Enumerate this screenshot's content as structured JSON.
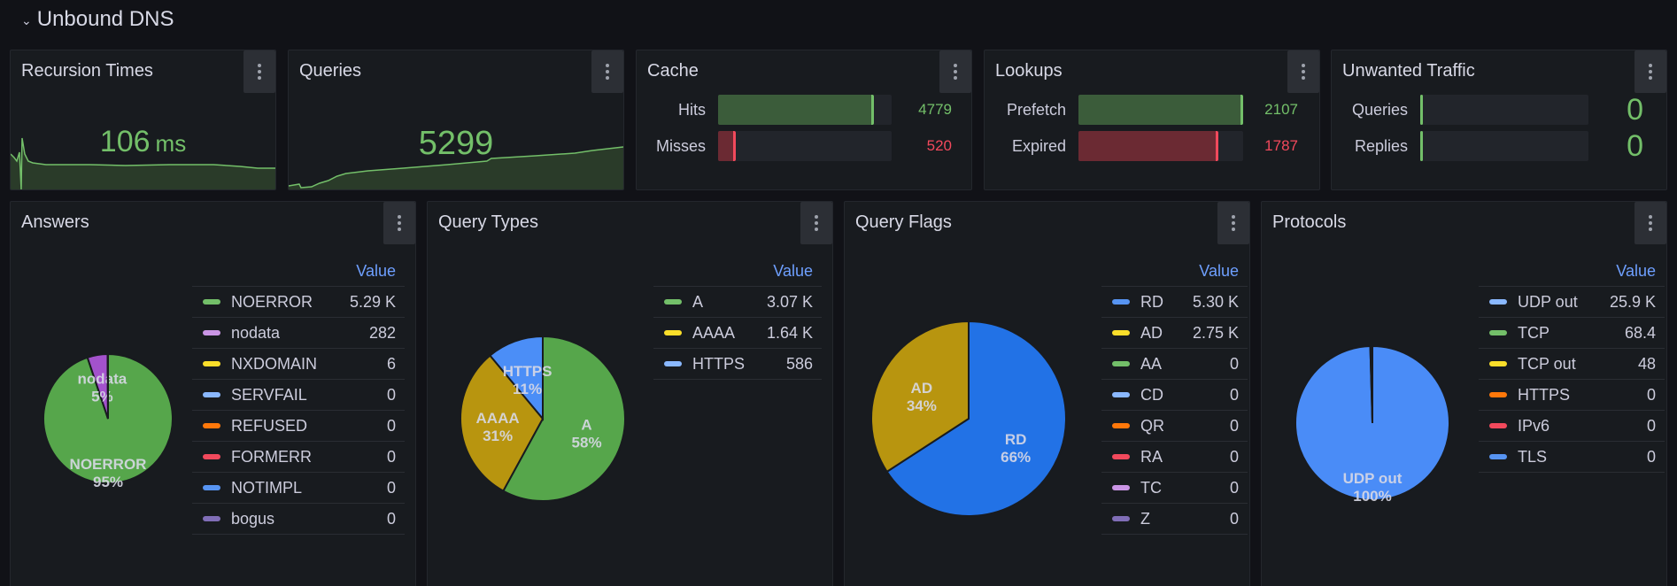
{
  "row": {
    "title": "Unbound DNS",
    "chevron": "chevron-down-icon"
  },
  "colors": {
    "green": "#73bf69",
    "green_fill": "#3b5c3a",
    "red": "#f2495c",
    "red_fill": "#6b2a33",
    "value_header": "#6e9fff"
  },
  "stats": {
    "recursion": {
      "title": "Recursion Times",
      "value": "106",
      "unit": "ms"
    },
    "queries": {
      "title": "Queries",
      "value": "5299"
    }
  },
  "cache": {
    "title": "Cache",
    "rows": [
      {
        "label": "Hits",
        "value": "4779",
        "fraction": 0.9,
        "color": "green"
      },
      {
        "label": "Misses",
        "value": "520",
        "fraction": 0.1,
        "color": "red"
      }
    ]
  },
  "lookups": {
    "title": "Lookups",
    "rows": [
      {
        "label": "Prefetch",
        "value": "2107",
        "fraction": 1.0,
        "color": "green"
      },
      {
        "label": "Expired",
        "value": "1787",
        "fraction": 0.85,
        "color": "red"
      }
    ]
  },
  "unwanted": {
    "title": "Unwanted Traffic",
    "rows": [
      {
        "label": "Queries",
        "value": "0",
        "fraction": 0,
        "color": "green"
      },
      {
        "label": "Replies",
        "value": "0",
        "fraction": 0,
        "color": "green"
      }
    ]
  },
  "legend_header": "Value",
  "chart_data": [
    {
      "type": "pie",
      "title": "Answers",
      "slices": [
        {
          "name": "NOERROR",
          "display": "5.29 K",
          "value": 5290,
          "color": "#73bf69",
          "fill": "#56a64b",
          "label": "NOERROR",
          "pct": "95%"
        },
        {
          "name": "nodata",
          "display": "282",
          "value": 282,
          "color": "#ca95e5",
          "fill": "#a352cc",
          "label": "nodata",
          "pct": "5%"
        },
        {
          "name": "NXDOMAIN",
          "display": "6",
          "value": 6,
          "color": "#fade2a",
          "fill": "#e0b400"
        },
        {
          "name": "SERVFAIL",
          "display": "0",
          "value": 0,
          "color": "#8ab8ff"
        },
        {
          "name": "REFUSED",
          "display": "0",
          "value": 0,
          "color": "#ff780a"
        },
        {
          "name": "FORMERR",
          "display": "0",
          "value": 0,
          "color": "#f2495c"
        },
        {
          "name": "NOTIMPL",
          "display": "0",
          "value": 0,
          "color": "#5794f2"
        },
        {
          "name": "bogus",
          "display": "0",
          "value": 0,
          "color": "#806eb7"
        }
      ]
    },
    {
      "type": "pie",
      "title": "Query Types",
      "slices": [
        {
          "name": "A",
          "display": "3.07 K",
          "value": 3070,
          "color": "#73bf69",
          "fill": "#56a64b",
          "label": "A",
          "pct": "58%"
        },
        {
          "name": "AAAA",
          "display": "1.64 K",
          "value": 1640,
          "color": "#fade2a",
          "fill": "#b8950f",
          "label": "AAAA",
          "pct": "31%"
        },
        {
          "name": "HTTPS",
          "display": "586",
          "value": 586,
          "color": "#8ab8ff",
          "fill": "#4b8ef7",
          "label": "HTTPS",
          "pct": "11%"
        }
      ]
    },
    {
      "type": "pie",
      "title": "Query Flags",
      "slices": [
        {
          "name": "RD",
          "display": "5.30 K",
          "value": 5300,
          "color": "#5794f2",
          "fill": "#2272e6",
          "label": "RD",
          "pct": "66%"
        },
        {
          "name": "AD",
          "display": "2.75 K",
          "value": 2750,
          "color": "#fade2a",
          "fill": "#b8950f",
          "label": "AD",
          "pct": "34%"
        },
        {
          "name": "AA",
          "display": "0",
          "value": 0,
          "color": "#73bf69"
        },
        {
          "name": "CD",
          "display": "0",
          "value": 0,
          "color": "#8ab8ff"
        },
        {
          "name": "QR",
          "display": "0",
          "value": 0,
          "color": "#ff780a"
        },
        {
          "name": "RA",
          "display": "0",
          "value": 0,
          "color": "#f2495c"
        },
        {
          "name": "TC",
          "display": "0",
          "value": 0,
          "color": "#ca95e5"
        },
        {
          "name": "Z",
          "display": "0",
          "value": 0,
          "color": "#806eb7"
        }
      ]
    },
    {
      "type": "pie",
      "title": "Protocols",
      "slices": [
        {
          "name": "UDP out",
          "display": "25.9 K",
          "value": 25900,
          "color": "#8ab8ff",
          "fill": "#4a8cf7",
          "label": "UDP out",
          "pct": "100%"
        },
        {
          "name": "TCP",
          "display": "68.4",
          "value": 68.4,
          "color": "#73bf69",
          "fill": "#56a64b"
        },
        {
          "name": "TCP out",
          "display": "48",
          "value": 48,
          "color": "#fade2a",
          "fill": "#e0b400"
        },
        {
          "name": "HTTPS",
          "display": "0",
          "value": 0,
          "color": "#ff780a"
        },
        {
          "name": "IPv6",
          "display": "0",
          "value": 0,
          "color": "#f2495c"
        },
        {
          "name": "TLS",
          "display": "0",
          "value": 0,
          "color": "#5794f2"
        }
      ]
    }
  ]
}
